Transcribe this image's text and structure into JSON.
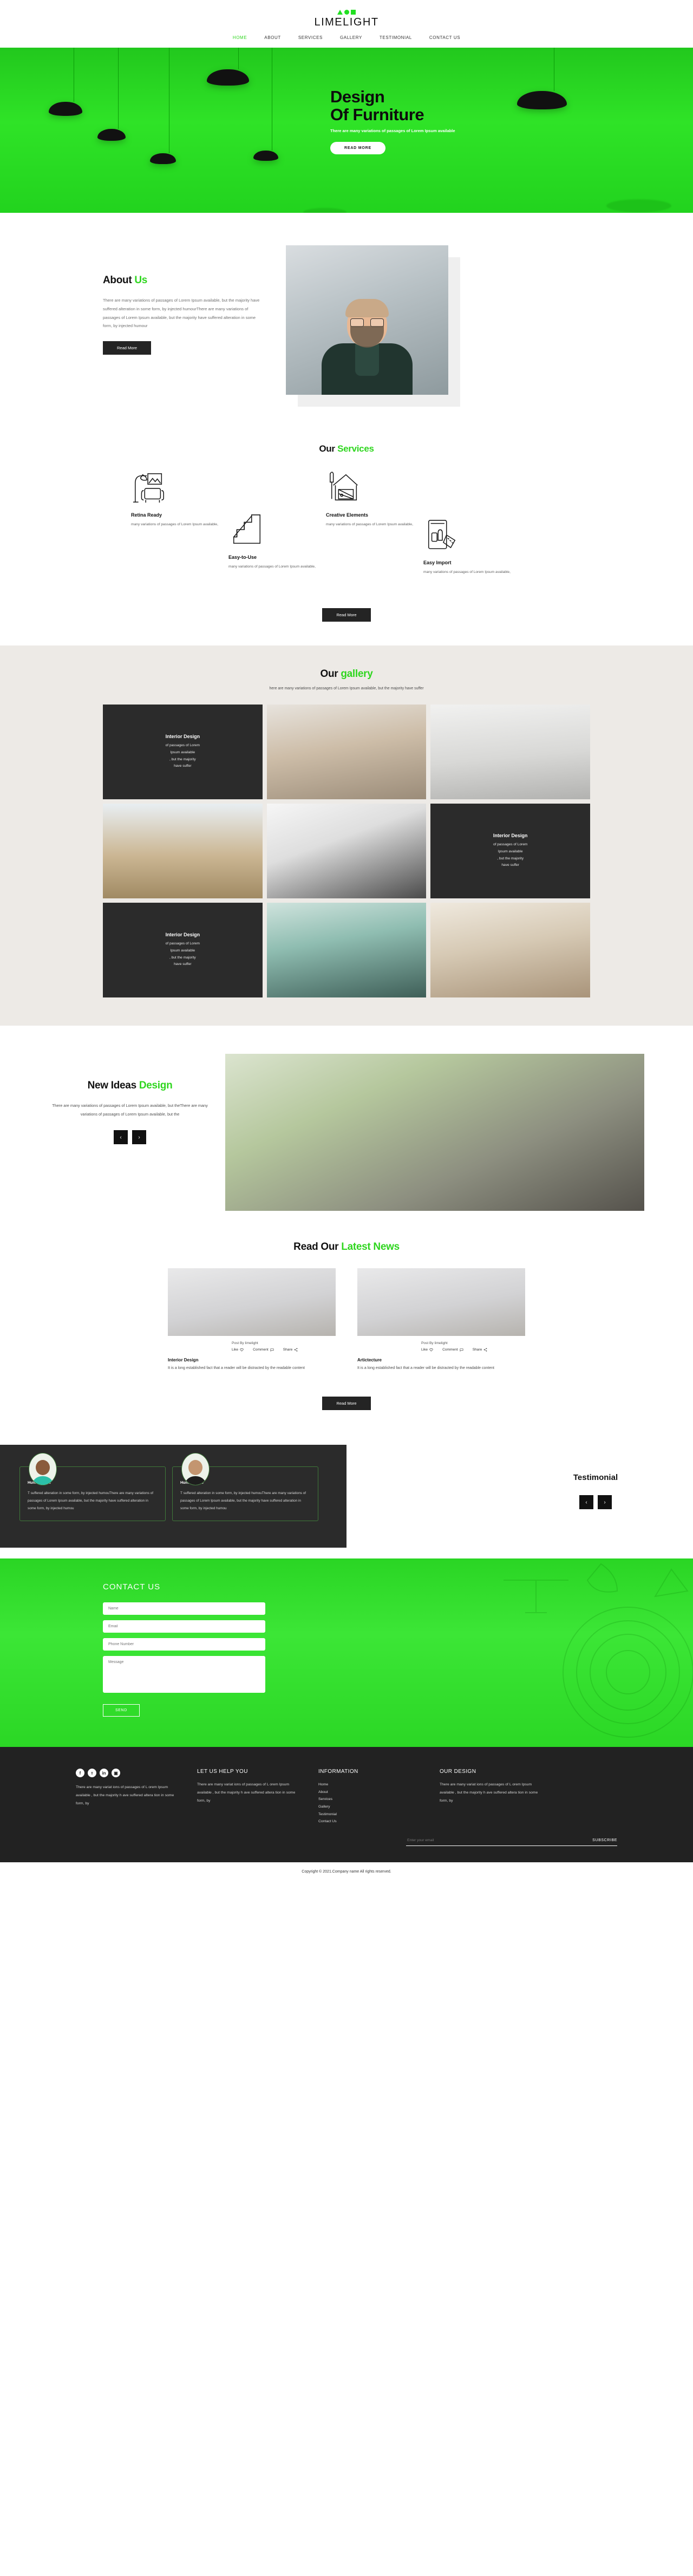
{
  "brand": {
    "name": "LIMELIGHT",
    "accent": "#2fd61f",
    "mark_shapes": [
      "triangle",
      "circle",
      "square"
    ]
  },
  "nav": {
    "items": [
      {
        "label": "HOME",
        "active": true
      },
      {
        "label": "ABOUT",
        "active": false
      },
      {
        "label": "SERVICES",
        "active": false
      },
      {
        "label": "GALLERY",
        "active": false
      },
      {
        "label": "TESTIMONIAL",
        "active": false
      },
      {
        "label": "CONTACT US",
        "active": false
      }
    ]
  },
  "hero": {
    "title_line1": "Design",
    "title_line2": "Of Furniture",
    "subtitle": "There are many variations of passages of Lorem Ipsum available",
    "button": "READ MORE"
  },
  "about": {
    "title_main": "About ",
    "title_accent": "Us",
    "body": "There are many variations of passages of Lorem Ipsum available, but the majority have suffered alteration in some form, by injected humourThere are many variations of passages of Lorem Ipsum available, but the majority have suffered alteration in some form, by injected humour",
    "button": "Read More"
  },
  "services": {
    "title_main": "Our ",
    "title_accent": "Services",
    "items": [
      {
        "icon": "floor-lamp-armchair-icon",
        "title": "Retina Ready",
        "desc": "many variations of passages of Lorem Ipsum available,"
      },
      {
        "icon": "staircase-icon",
        "title": "Easy-to-Use",
        "desc": "many variations of passages of Lorem Ipsum available,"
      },
      {
        "icon": "house-paintbrush-icon",
        "title": "Creative Elements",
        "desc": "many variations of passages of Lorem Ipsum available,"
      },
      {
        "icon": "sofa-ruler-icon",
        "title": "Easy Import",
        "desc": "many variations of passages of Lorem Ipsum available,"
      }
    ],
    "button": "Read More"
  },
  "gallery": {
    "title_main": "Our ",
    "title_accent": "gallery",
    "subtitle": "here are many variations of passages of Lorem Ipsum available, but the majority have suffer",
    "cells": [
      {
        "type": "card",
        "title": "Interior Design",
        "lines": [
          "of passages of Lorem",
          "Ipsum available",
          ", but the majority",
          "have suffer"
        ]
      },
      {
        "type": "photo",
        "name": "dining-room-chandelier-photo"
      },
      {
        "type": "photo",
        "name": "dining-table-white-room-photo"
      },
      {
        "type": "photo",
        "name": "wooden-staircase-photo"
      },
      {
        "type": "photo",
        "name": "white-kitchen-photo"
      },
      {
        "type": "card",
        "title": "Interior Design",
        "lines": [
          "of passages of Lorem",
          "Ipsum available",
          ", but the majority",
          "have suffer"
        ]
      },
      {
        "type": "card",
        "title": "Interior Design",
        "lines": [
          "of passages of Lorem",
          "Ipsum available",
          ", but the majority",
          "have suffer"
        ]
      },
      {
        "type": "photo",
        "name": "green-palm-wallpaper-photo"
      },
      {
        "type": "photo",
        "name": "bright-living-room-photo"
      }
    ]
  },
  "ideas": {
    "title_main": "New Ideas ",
    "title_accent": "Design",
    "body": "There are many variations of passages of Lorem Ipsum available, but theThere are many variations of passages of Lorem Ipsum available, but the",
    "prev": "‹",
    "next": "›",
    "photo": "living-room-palm-wallpaper-photo"
  },
  "news": {
    "title_main": "Read Our ",
    "title_accent": "Latest News",
    "button": "Read More",
    "posts": [
      {
        "image": "kitchen-counter-plant-photo",
        "by": "Post By limelight",
        "actions": [
          {
            "label": "Like",
            "icon": "heart-icon"
          },
          {
            "label": "Comment",
            "icon": "comment-icon"
          },
          {
            "label": "Share",
            "icon": "share-icon"
          }
        ],
        "title": "Interior Design",
        "body": "It is a long established fact that a reader will be distracted by the readable content"
      },
      {
        "image": "kitchen-counter-plant-photo",
        "by": "Post By limelight",
        "actions": [
          {
            "label": "Like",
            "icon": "heart-icon"
          },
          {
            "label": "Comment",
            "icon": "comment-icon"
          },
          {
            "label": "Share",
            "icon": "share-icon"
          }
        ],
        "title": "Artictecture",
        "body": "It is a long established fact that a reader will be distracted by the readable content"
      }
    ]
  },
  "testimonial": {
    "heading": "Testimonial",
    "prev": "‹",
    "next": "›",
    "cards": [
      {
        "avatar": "smiling-man-avatar",
        "name": "HumouThere",
        "quote": "T suffered alteration in some form, by injected humouThere are many variations of passages of Lorem Ipsum available, but the majority have suffered alteration in some form, by injected humou"
      },
      {
        "avatar": "young-man-avatar",
        "name": "HumouThere",
        "quote": "T suffered alteration in some form, by injected humouThere are many variations of passages of Lorem Ipsum available, but the majority have suffered alteration in some form, by injected humou"
      }
    ]
  },
  "contact": {
    "heading": "CONTACT US",
    "fields": [
      {
        "name": "name-field",
        "placeholder": "Name",
        "value": ""
      },
      {
        "name": "email-field",
        "placeholder": "Email",
        "value": ""
      },
      {
        "name": "phone-field",
        "placeholder": "Phone Number",
        "value": ""
      }
    ],
    "message_placeholder": "Message",
    "message_value": "",
    "button": "SEND"
  },
  "footer": {
    "socials": [
      {
        "name": "facebook-icon",
        "glyph": "f"
      },
      {
        "name": "twitter-icon",
        "glyph": "ᴛ"
      },
      {
        "name": "linkedin-icon",
        "glyph": "in"
      },
      {
        "name": "instagram-icon",
        "glyph": "▣"
      }
    ],
    "about_text": "There are many variat ions of passages of L orem Ipsum available , but the majority h ave suffered altera tion in some form, by",
    "help": {
      "title": "LET US HELP YOU",
      "text": "There are many variat ions of passages of L orem Ipsum available , but the majority h ave suffered altera tion in some form, by"
    },
    "information": {
      "title": "INFORMATION",
      "links": [
        "Home",
        "About",
        "Services",
        "Gallery",
        "Testimonial",
        "Contact Us"
      ]
    },
    "our_design": {
      "title": "OUR DESIGN",
      "text": "There are many variat ions of passages of L orem Ipsum available , but the majority h ave suffered altera tion in some form, by"
    },
    "subscribe": {
      "placeholder": "Enter your email",
      "value": "",
      "button": "SUBSCRIBE"
    },
    "copyright": "Copyright © 2021.Company name All rights reserved."
  }
}
